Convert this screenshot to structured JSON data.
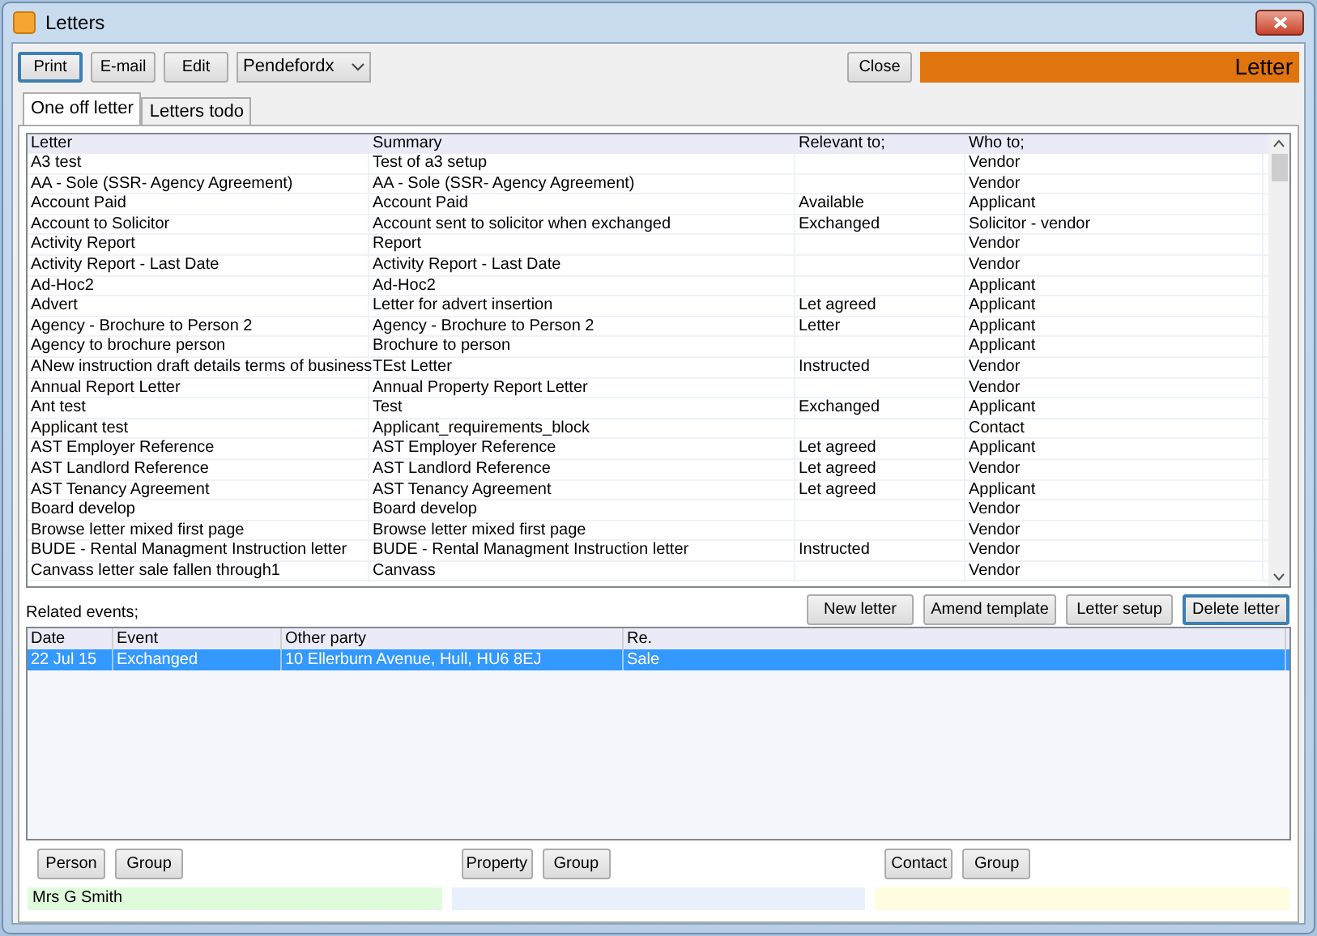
{
  "window": {
    "title": "Letters"
  },
  "toolbar": {
    "buttons": [
      {
        "label": "Print",
        "selected": true
      },
      {
        "label": "E-mail",
        "selected": false
      },
      {
        "label": "Edit",
        "selected": false
      }
    ],
    "branch_select": {
      "value": "Pendefordx"
    },
    "close_button": "Close",
    "banner": "Letter"
  },
  "tabs": [
    {
      "label": "One off letter",
      "selected": true
    },
    {
      "label": "Letters todo",
      "selected": false
    }
  ],
  "letters_table": {
    "columns": [
      "Letter",
      "Summary",
      "Relevant to;",
      "Who to;"
    ],
    "rows": [
      [
        "A3 test",
        "Test of a3 setup",
        "",
        "Vendor"
      ],
      [
        "AA - Sole (SSR- Agency Agreement)",
        "AA - Sole (SSR- Agency Agreement)",
        "",
        "Vendor"
      ],
      [
        "Account Paid",
        "Account Paid",
        "Available",
        "Applicant"
      ],
      [
        "Account to Solicitor",
        "Account sent to solicitor when exchanged",
        "Exchanged",
        "Solicitor - vendor"
      ],
      [
        "Activity Report",
        "Report",
        "",
        "Vendor"
      ],
      [
        "Activity Report - Last Date",
        "Activity Report - Last Date",
        "",
        "Vendor"
      ],
      [
        "Ad-Hoc2",
        "Ad-Hoc2",
        "",
        "Applicant"
      ],
      [
        "Advert",
        "Letter for advert insertion",
        "Let agreed",
        "Applicant"
      ],
      [
        "Agency - Brochure to Person 2",
        "Agency - Brochure to Person 2",
        "Letter",
        "Applicant"
      ],
      [
        "Agency to brochure person",
        "Brochure to person",
        "",
        "Applicant"
      ],
      [
        "ANew instruction draft details terms of business",
        "TEst Letter",
        "Instructed",
        "Vendor"
      ],
      [
        "Annual Report Letter",
        "Annual Property Report Letter",
        "",
        "Vendor"
      ],
      [
        "Ant  test",
        "Test",
        "Exchanged",
        "Applicant"
      ],
      [
        "Applicant test",
        "Applicant_requirements_block",
        "",
        "Contact"
      ],
      [
        "AST Employer Reference",
        "AST Employer Reference",
        "Let agreed",
        "Applicant"
      ],
      [
        "AST Landlord Reference",
        "AST Landlord Reference",
        "Let agreed",
        "Vendor"
      ],
      [
        "AST Tenancy Agreement",
        "AST Tenancy Agreement",
        "Let agreed",
        "Applicant"
      ],
      [
        "Board develop",
        "Board develop",
        "",
        "Vendor"
      ],
      [
        "Browse letter mixed first page",
        "Browse letter mixed first page",
        "",
        "Vendor"
      ],
      [
        "BUDE - Rental Managment Instruction letter",
        "BUDE - Rental Managment Instruction letter",
        "Instructed",
        "Vendor"
      ],
      [
        "Canvass letter sale fallen through1",
        "Canvass",
        "",
        "Vendor"
      ]
    ]
  },
  "letter_actions": [
    {
      "label": "New letter",
      "selected": false
    },
    {
      "label": "Amend template",
      "selected": false
    },
    {
      "label": "Letter setup",
      "selected": false
    },
    {
      "label": "Delete letter",
      "selected": true
    }
  ],
  "related_events": {
    "label": "Related events;",
    "columns": [
      "Date",
      "Event",
      "Other party",
      "Re."
    ],
    "rows": [
      {
        "cells": [
          "22 Jul 15",
          "Exchanged",
          "10 Ellerburn Avenue, Hull, HU6 8EJ",
          "Sale"
        ],
        "selected": true
      }
    ]
  },
  "parties": [
    {
      "buttons": [
        "Person",
        "Group"
      ],
      "value": "Mrs G Smith",
      "color": "#e0fbdc"
    },
    {
      "buttons": [
        "Property",
        "Group"
      ],
      "color": "#eaf0fb"
    },
    {
      "buttons": [
        "Contact",
        "Group"
      ],
      "color": "#fffde0"
    }
  ]
}
